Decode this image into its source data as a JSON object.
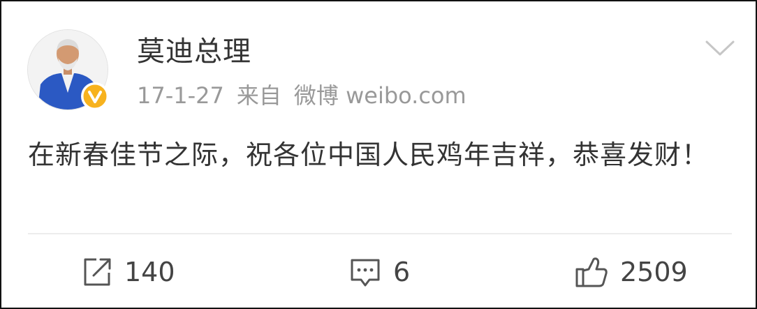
{
  "post": {
    "author": "莫迪总理",
    "date": "17-1-27",
    "source_prefix": "来自",
    "source_name": "微博 weibo.com",
    "text": "在新春佳节之际，祝各位中国人民鸡年吉祥，恭喜发财！",
    "verified": true
  },
  "actions": {
    "repost_count": "140",
    "comment_count": "6",
    "like_count": "2509"
  },
  "icons": {
    "verified": "verified-badge-icon",
    "menu": "chevron-down-icon",
    "repost": "repost-icon",
    "comment": "comment-icon",
    "like": "thumbs-up-icon"
  },
  "colors": {
    "verified_badge": "#f7b21e",
    "text": "#333333",
    "meta": "#999999",
    "divider": "#ececec"
  }
}
